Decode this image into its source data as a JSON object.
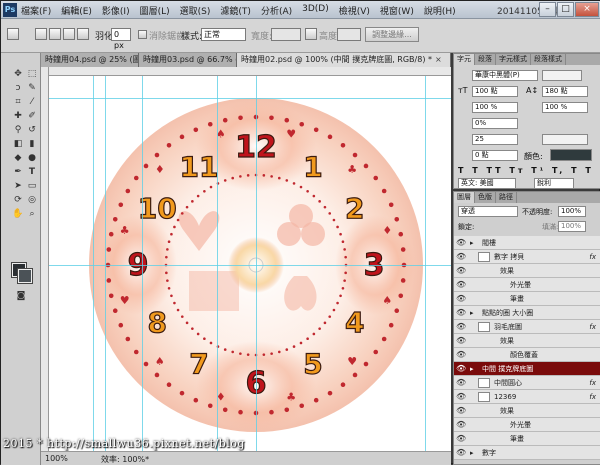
{
  "app": {
    "title": "20141105 工具區",
    "logo": "Ps",
    "window_buttons": [
      "–",
      "□",
      "×"
    ]
  },
  "menu": [
    "檔案(F)",
    "編輯(E)",
    "影像(I)",
    "圖層(L)",
    "選取(S)",
    "濾鏡(T)",
    "分析(A)",
    "3D(D)",
    "檢視(V)",
    "視窗(W)",
    "說明(H)"
  ],
  "options": {
    "feather_label": "羽化:",
    "feather_value": "0 px",
    "antialias_label": "消除鋸齒",
    "style_label": "樣式:",
    "style_value": "正常",
    "width_label": "寬度:",
    "height_label": "高度:",
    "refine_label": "調整邊緣..."
  },
  "tabs": [
    {
      "label": "時鐘用04.psd @ 25% (圖層..."
    },
    {
      "label": "時鐘用03.psd @ 66.7% (圖..."
    },
    {
      "label": "時鐘用02.psd @ 100% (中間 撲克牌底圖, RGB/8) *",
      "active": true
    }
  ],
  "clock": {
    "numbers": [
      "12",
      "1",
      "2",
      "3",
      "4",
      "5",
      "6",
      "7",
      "8",
      "9",
      "10",
      "11"
    ]
  },
  "status": {
    "zoom": "100%",
    "info": "效率: 100%*"
  },
  "watermark": "2015 * http://smallwu36.pixnet.net/blog",
  "character_panel": {
    "tabs": [
      "字元",
      "段落",
      "字元樣式",
      "段落樣式"
    ],
    "font": "華康中黑體(P)",
    "size1": "100 點",
    "size2": "180 點",
    "scale": "100 %",
    "scale2": "100 %",
    "tracking": "0%",
    "kerning": "25",
    "baseline": "0 點",
    "color_label": "顏色:",
    "language": "英文: 美國",
    "aa": "銳利"
  },
  "layers_panel": {
    "tabs": [
      "圖層",
      "色版",
      "路徑"
    ],
    "blend": "穿透",
    "opacity_label": "不透明度:",
    "opacity": "100%",
    "fill_label": "填滿:",
    "fill": "100%",
    "lock_label": "鎖定:",
    "layers": [
      {
        "name": "閥樓",
        "kind": "group"
      },
      {
        "name": "數字 拷貝",
        "kind": "layer",
        "fx": "fx"
      },
      {
        "name": "效果",
        "kind": "sub"
      },
      {
        "name": "外光暈",
        "kind": "sub2"
      },
      {
        "name": "筆畫",
        "kind": "sub2"
      },
      {
        "name": "點點的圈 大小圈",
        "kind": "group"
      },
      {
        "name": "羽毛底圖",
        "kind": "layer",
        "fx": "fx"
      },
      {
        "name": "效果",
        "kind": "sub"
      },
      {
        "name": "顏色覆蓋",
        "kind": "sub2"
      },
      {
        "name": "中間 撲克牌底圖",
        "kind": "group",
        "selected": true
      },
      {
        "name": "中間圓心",
        "kind": "layer",
        "fx": "fx"
      },
      {
        "name": "12369",
        "kind": "layer",
        "fx": "fx"
      },
      {
        "name": "效果",
        "kind": "sub"
      },
      {
        "name": "外光暈",
        "kind": "sub2"
      },
      {
        "name": "筆畫",
        "kind": "sub2"
      },
      {
        "name": "數字",
        "kind": "group"
      }
    ]
  }
}
